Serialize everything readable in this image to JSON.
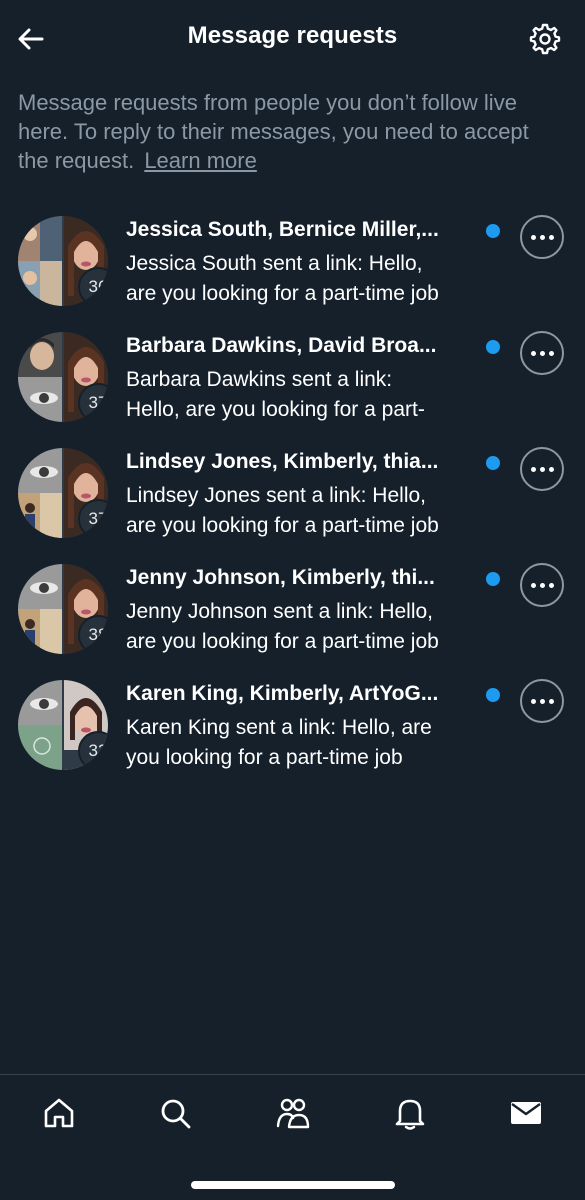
{
  "header": {
    "title": "Message requests",
    "back_icon": "arrow-left-icon",
    "settings_icon": "gear-icon"
  },
  "intro": {
    "text": "Message requests from people you don’t follow live here. To reply to their messages, you need to accept the request.",
    "link": "Learn more"
  },
  "requests": [
    {
      "names": "Jessica South, Bernice Miller,...",
      "preview_1": "Jessica South sent a link: Hello,",
      "preview_2": "are you looking for a part-time job",
      "count": "36",
      "unread": true
    },
    {
      "names": "Barbara Dawkins, David Broa...",
      "preview_1": "Barbara Dawkins sent a link:",
      "preview_2": "Hello, are you looking for a part-",
      "count": "37",
      "unread": true
    },
    {
      "names": "Lindsey Jones, Kimberly, thia...",
      "preview_1": "Lindsey Jones sent a link: Hello,",
      "preview_2": "are you looking for a part-time job",
      "count": "37",
      "unread": true
    },
    {
      "names": "Jenny Johnson, Kimberly, thi...",
      "preview_1": "Jenny Johnson sent a link: Hello,",
      "preview_2": "are you looking for a part-time job",
      "count": "38",
      "unread": true
    },
    {
      "names": "Karen King, Kimberly, ArtYoG...",
      "preview_1": "Karen King sent a link: Hello, are",
      "preview_2": "you looking for a part-time job",
      "count": "33",
      "unread": true
    }
  ],
  "nav": {
    "items": [
      "home-icon",
      "search-icon",
      "communities-icon",
      "notifications-icon",
      "messages-icon"
    ]
  },
  "colors": {
    "background": "#15202b",
    "accent": "#1d9bf0",
    "secondary_text": "#8b98a5"
  }
}
